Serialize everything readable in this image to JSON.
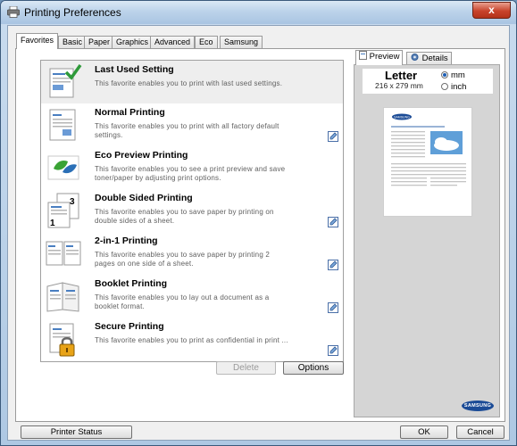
{
  "window": {
    "title": "Printing Preferences",
    "close_label": "x"
  },
  "tabs": [
    "Favorites",
    "Basic",
    "Paper",
    "Graphics",
    "Advanced",
    "Eco",
    "Samsung"
  ],
  "favorites": [
    {
      "title": "Last Used Setting",
      "desc": [
        "This favorite enables you to print with last used settings."
      ],
      "icon": "last-used-doc-icon"
    },
    {
      "title": "Normal Printing",
      "desc": [
        "This favorite enables you to print with all factory default",
        "settings."
      ],
      "icon": "normal-doc-icon"
    },
    {
      "title": "Eco Preview Printing",
      "desc": [
        "This favorite enables you to see a print preview and save",
        "toner/paper by adjusting print options."
      ],
      "icon": "eco-leaf-icon"
    },
    {
      "title": "Double Sided Printing",
      "desc": [
        "This favorite enables you to save paper by printing on",
        "double sides of a sheet."
      ],
      "icon": "duplex-pages-icon"
    },
    {
      "title": "2-in-1 Printing",
      "desc": [
        "This favorite enables you to save paper by printing 2",
        "pages on one side of a sheet."
      ],
      "icon": "two-in-one-icon"
    },
    {
      "title": "Booklet Printing",
      "desc": [
        "This favorite enables you to lay out a document as a",
        "booklet format."
      ],
      "icon": "booklet-icon"
    },
    {
      "title": "Secure Printing",
      "desc": [
        "This favorite enables you to print as confidential in print ..."
      ],
      "icon": "secure-lock-icon"
    }
  ],
  "buttons": {
    "delete": "Delete",
    "options": "Options"
  },
  "preview": {
    "tab_preview": "Preview",
    "tab_details": "Details",
    "paper_name": "Letter",
    "paper_size": "216 x 279 mm",
    "unit_mm": "mm",
    "unit_inch": "inch",
    "selected_unit": "mm",
    "page_logo": "SAMSUNG"
  },
  "brand": "SAMSUNG",
  "footer": {
    "printer_status": "Printer Status",
    "ok": "OK",
    "cancel": "Cancel"
  },
  "colors": {
    "accent": "#1b4b96",
    "titlebar": "#bcd3ea",
    "close": "#c8432b",
    "eco_green": "#3aa335"
  }
}
